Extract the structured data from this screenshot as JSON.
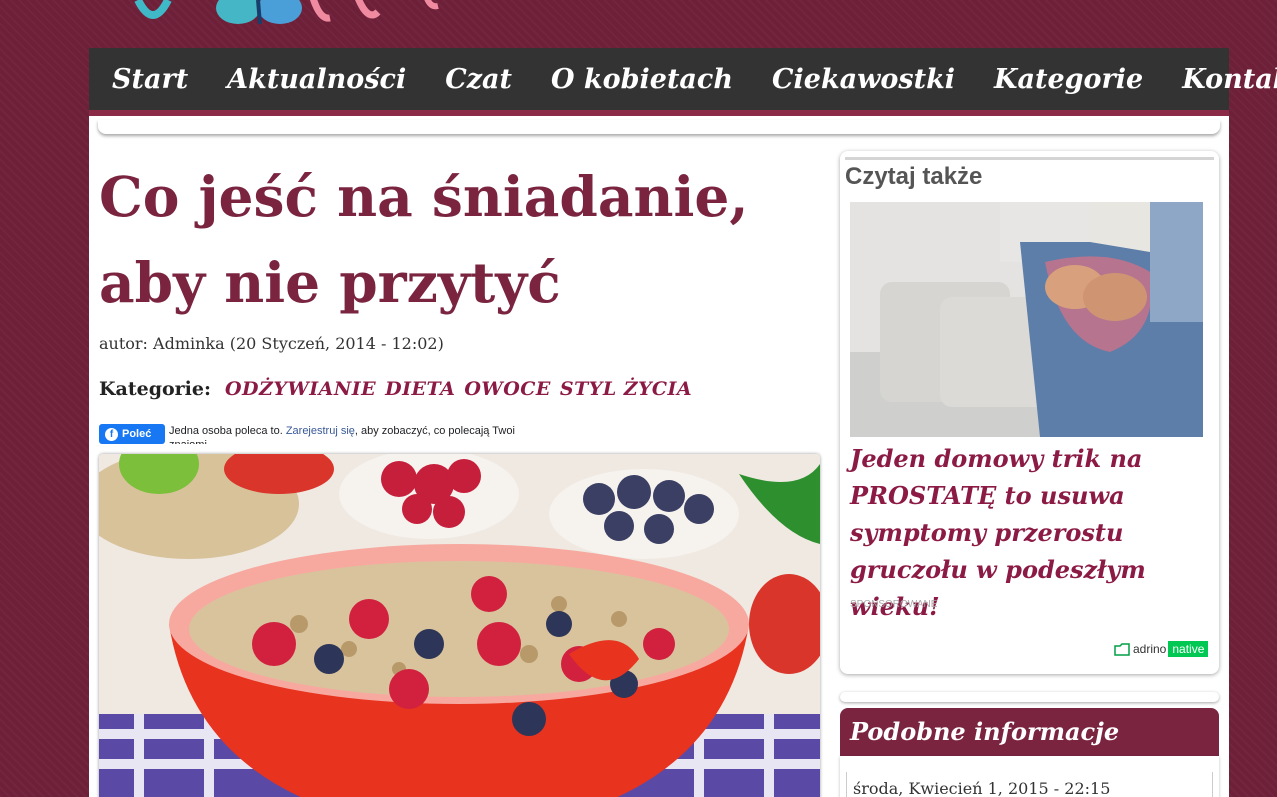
{
  "nav": {
    "items": [
      "Start",
      "Aktualności",
      "Czat",
      "O kobietach",
      "Ciekawostki",
      "Kategorie",
      "Kontakt"
    ]
  },
  "article": {
    "title": "Co jeść na śniadanie, aby nie przytyć",
    "author_line": "autor: Adminka (20 Styczeń, 2014 - 12:02)",
    "categories_label": "Kategorie:",
    "categories": [
      "ODŻYWIANIE",
      "DIETA",
      "OWOCE",
      "STYL ŻYCIA"
    ]
  },
  "facebook": {
    "button_label": "Poleć",
    "text_before": "Jedna osoba poleca to. ",
    "link_text": "Zarejestruj się",
    "text_after": ", aby zobaczyć, co polecają Twoi znajomi."
  },
  "sidebar": {
    "read_also_heading": "Czytaj także",
    "ad": {
      "headline": "Jeden domowy trik na PROSTATĘ to usuwa symptomy przerostu gruczołu w podeszłym wieku!",
      "sponsored_label": "SPONSOROWANE",
      "brand_name": "adrino",
      "brand_tag": "native"
    },
    "related_heading": "Podobne informacje",
    "related_items": [
      {
        "date": "środa, Kwiecień 1, 2015 - 22:15"
      }
    ]
  },
  "colors": {
    "background": "#6e2039",
    "nav_bg": "#333333",
    "accent": "#7a2440",
    "ad_headline": "#8b1a44",
    "facebook_blue": "#1877f2",
    "adrino_green": "#00c853"
  },
  "icons": [
    "butterfly-logo",
    "facebook-icon",
    "adrino-logo-icon"
  ]
}
